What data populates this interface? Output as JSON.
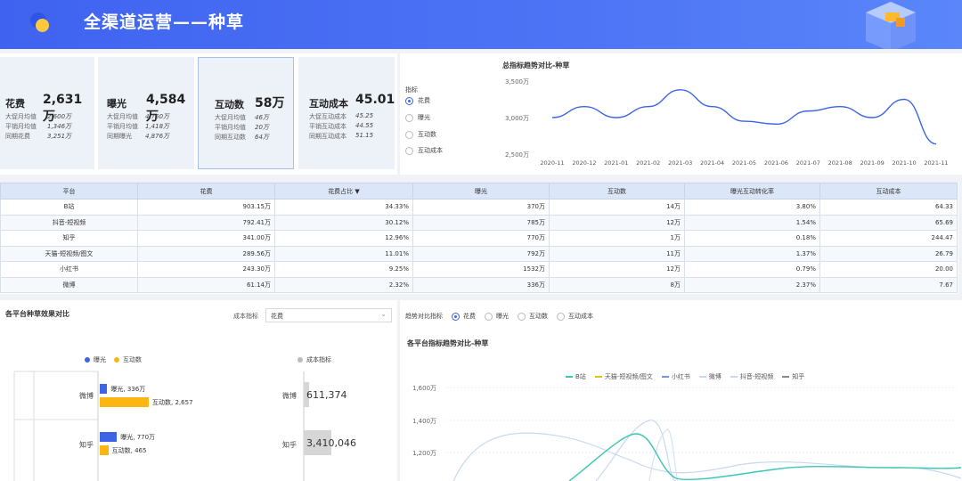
{
  "header": {
    "title": "全渠道运营——种草"
  },
  "kpis": [
    {
      "name": "花费",
      "value": "2,631万",
      "rows": [
        [
          "大促月均值",
          "2,600万"
        ],
        [
          "平销月均值",
          "1,346万"
        ],
        [
          "同期花费",
          "3,251万"
        ]
      ]
    },
    {
      "name": "曝光",
      "value": "4,584万",
      "rows": [
        [
          "大促月均值",
          "4,750万"
        ],
        [
          "平销月均值",
          "1,418万"
        ],
        [
          "同期曝光",
          "4,876万"
        ]
      ]
    },
    {
      "name": "互动数",
      "value": "58万",
      "rows": [
        [
          "大促月均值",
          "46万"
        ],
        [
          "平销月均值",
          "20万"
        ],
        [
          "同期互动数",
          "64万"
        ]
      ]
    },
    {
      "name": "互动成本",
      "value": "45.01",
      "rows": [
        [
          "大促互动成本",
          "45.25"
        ],
        [
          "平销互动成本",
          "44.55"
        ],
        [
          "同期互动成本",
          "51.15"
        ]
      ]
    }
  ],
  "trend": {
    "title": "总指标趋势对比-种草",
    "legend_label": "指标",
    "options": [
      "花费",
      "曝光",
      "互动数",
      "互动成本"
    ],
    "selected": "花费"
  },
  "chart_data": [
    {
      "type": "line",
      "title": "总指标趋势对比-种草",
      "x": [
        "2020-11",
        "2020-12",
        "2021-01",
        "2021-02",
        "2021-03",
        "2021-04",
        "2021-05",
        "2021-06",
        "2021-07",
        "2021-08",
        "2021-09",
        "2021-10",
        "2021-11"
      ],
      "y_ticks": [
        "3,500万",
        "3,000万",
        "2,500万"
      ],
      "ylim": [
        2500,
        3500
      ],
      "series": [
        {
          "values": [
            3000,
            3150,
            3000,
            3150,
            3380,
            3150,
            2950,
            2910,
            3090,
            3150,
            3000,
            3250,
            2640
          ]
        }
      ]
    },
    {
      "type": "bar",
      "title": "各平台种草效果对比",
      "categories": [
        "微博",
        "知乎"
      ],
      "series": [
        {
          "name": "曝光",
          "values": [
            336,
            770
          ],
          "labels": [
            "曝光, 336万",
            "曝光, 770万"
          ]
        },
        {
          "name": "互动数",
          "values": [
            2657,
            465
          ],
          "labels": [
            "互动数, 2,657",
            "互动数, 465"
          ]
        },
        {
          "name": "成本指标",
          "values": [
            611374,
            3410046
          ],
          "labels": [
            "611,374",
            "3,410,046"
          ]
        }
      ]
    },
    {
      "type": "line",
      "title": "各平台指标趋势对比-种草",
      "y_ticks": [
        "1,600万",
        "1,400万",
        "1,200万"
      ],
      "ylim": [
        1100,
        1650
      ],
      "series": [
        {
          "name": "B站"
        },
        {
          "name": "天猫-短视频/图文"
        },
        {
          "name": "小红书"
        },
        {
          "name": "微博"
        },
        {
          "name": "抖音-短视频"
        },
        {
          "name": "知乎"
        }
      ]
    }
  ],
  "table": {
    "headers": [
      "平台",
      "花费",
      "花费占比 ▼",
      "曝光",
      "互动数",
      "曝光互动转化率",
      "互动成本"
    ],
    "rows": [
      [
        "B站",
        "903.15万",
        "34.33%",
        "370万",
        "14万",
        "3.80%",
        "64.33"
      ],
      [
        "抖音-短视频",
        "792.41万",
        "30.12%",
        "785万",
        "12万",
        "1.54%",
        "65.69"
      ],
      [
        "知乎",
        "341.00万",
        "12.96%",
        "770万",
        "1万",
        "0.18%",
        "244.47"
      ],
      [
        "天猫-短视频/图文",
        "289.56万",
        "11.01%",
        "792万",
        "11万",
        "1.37%",
        "26.79"
      ],
      [
        "小红书",
        "243.30万",
        "9.25%",
        "1532万",
        "12万",
        "0.79%",
        "20.00"
      ],
      [
        "微博",
        "61.14万",
        "2.32%",
        "336万",
        "8万",
        "2.37%",
        "7.67"
      ]
    ]
  },
  "platform_compare": {
    "title": "各平台种草效果对比",
    "select_label": "成本指标",
    "select_value": "花费",
    "legend": [
      "曝光",
      "互动数"
    ],
    "cost_legend": "成本指标",
    "platforms": [
      "微博",
      "知乎"
    ]
  },
  "platform_trend": {
    "label": "趋势对比指标",
    "options": [
      "花费",
      "曝光",
      "互动数",
      "互动成本"
    ],
    "selected": "花费",
    "title": "各平台指标趋势对比-种草"
  },
  "colors": {
    "primary": "#3c64e8",
    "exposure": "#3d63e6",
    "interaction": "#fbb614"
  }
}
